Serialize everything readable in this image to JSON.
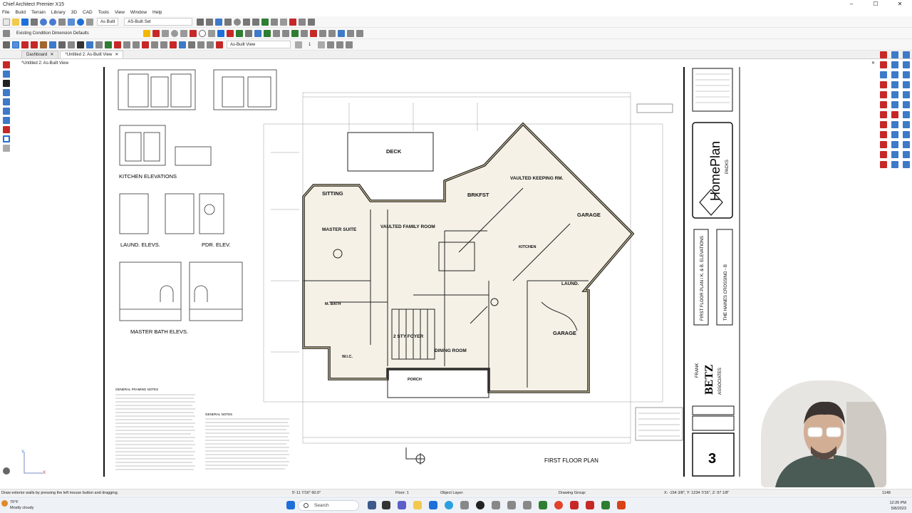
{
  "app": {
    "title": "Chief Architect Premier X15",
    "window_controls": [
      "–",
      "☐",
      "✕"
    ]
  },
  "menu": [
    "File",
    "Build",
    "Terrain",
    "Library",
    "3D",
    "CAD",
    "Tools",
    "View",
    "Window",
    "Help"
  ],
  "toolbar": {
    "layer_set": "As Built",
    "plan_set": "AS-Built Set",
    "dimension_defaults": "Existing Condition Dimension Defaults",
    "view_name": "As-Built View",
    "floor_number": "1"
  },
  "tabs": [
    {
      "label": "Dashboard",
      "close": "✕",
      "active": false
    },
    {
      "label": "*Untitled 2: As-Built View",
      "close": "✕",
      "active": true
    }
  ],
  "view_title": "*Untitled 2: As-Built View",
  "view_close": "✕",
  "sheet": {
    "elevation_labels": [
      "KITCHEN ELEVATIONS",
      "LAUND. ELEVS.",
      "PDR. ELEV.",
      "MASTER BATH ELEVS."
    ],
    "notes_titles": [
      "GENERAL FRAMING NOTES",
      "GENERAL NOTES"
    ],
    "room_labels": [
      "DECK",
      "SITTING",
      "BRKFST",
      "VAULTED KEEPING RM.",
      "VAULTED FAMILY ROOM",
      "MASTER SUITE",
      "GARAGE",
      "KITCHEN",
      "LAUND.",
      "M. BATH",
      "W.I.C.",
      "2 STY FOYER",
      "DINING ROOM",
      "PORCH",
      "GARAGE"
    ],
    "plan_title": "FIRST FLOOR PLAN",
    "title_block": {
      "brand": "HomePlan",
      "brand_sub": "PACKS",
      "sheet_desc": "FIRST FLOOR PLAN / K. & B. ELEVATIONS",
      "plan_name": "THE HAINES CROSSING - B",
      "company_top": "FRANK",
      "company": "BETZ",
      "company_sub": "ASSOCIATES",
      "sheet_number": "3"
    }
  },
  "axes": {
    "y": "Y",
    "x": "X"
  },
  "status": {
    "hint": "Draw exterior walls by pressing the left mouse button and dragging.",
    "measure": "5'-11 7/16\" 60.0°",
    "floor": "Floor: 1",
    "object_layer": "Object Layer:",
    "drawing_group": "Drawing Group:",
    "coords": "X: -154 3/8\", Y: 1234 7/16\", Z: 97 1/8\"",
    "zoom": "1148"
  },
  "taskbar": {
    "temp": "70°F",
    "weather": "Mostly cloudy",
    "search": "Search",
    "time": "12:26 PM",
    "date": "5/8/2023"
  },
  "colors": {
    "accent_blue": "#1e6fd9",
    "toolbar_red": "#c62828",
    "toolbar_green": "#2e7d32",
    "plan_ink": "#1c1c1c",
    "wall_fill": "#d6c7a0"
  },
  "icons": [
    "new-file-icon",
    "open-icon",
    "save-icon",
    "print-icon",
    "undo-icon",
    "redo-icon",
    "help-icon",
    "select-icon",
    "wall-tool-icon",
    "door-icon",
    "window-icon",
    "stairs-icon",
    "cabinet-icon",
    "dimension-icon",
    "text-icon",
    "camera-icon",
    "search-icon",
    "windows-start-icon",
    "gear-icon"
  ]
}
